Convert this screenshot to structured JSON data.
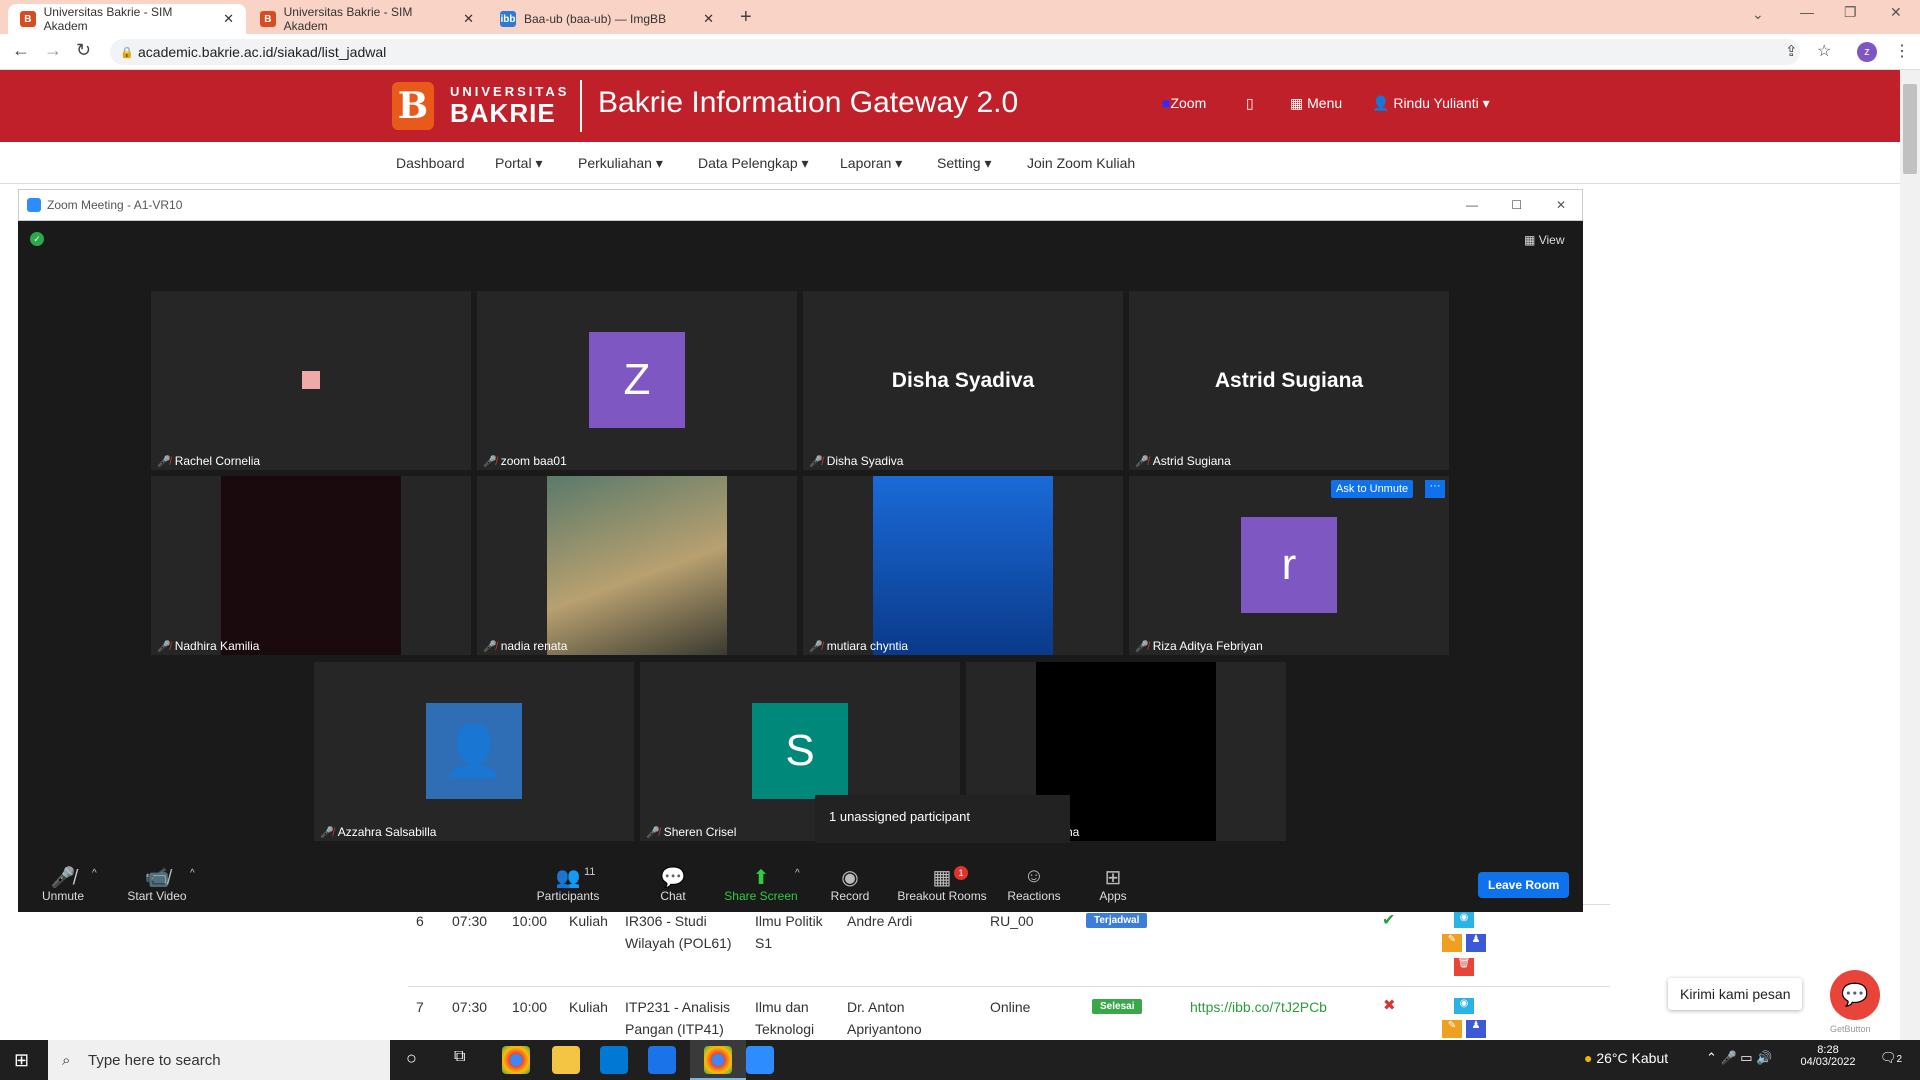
{
  "browser": {
    "tabs": [
      {
        "title": "Universitas Bakrie - SIM Akadem",
        "favicon": "B"
      },
      {
        "title": "Universitas Bakrie - SIM Akadem",
        "favicon": "B"
      },
      {
        "title": "Baa-ub (baa-ub) — ImgBB",
        "favicon": "ibb"
      }
    ],
    "url": "academic.bakrie.ac.id/siakad/list_jadwal"
  },
  "site": {
    "logo_letter": "B",
    "logo_top": "UNIVERSITAS",
    "logo_bottom": "BAKRIE",
    "title": "Bakrie Information Gateway 2.0",
    "zoom_label": "Zoom",
    "menu_label": "Menu",
    "user_label": "Rindu Yulianti ▾",
    "nav": [
      "Dashboard",
      "Portal ▾",
      "Perkuliahan ▾",
      "Data Pelengkap ▾",
      "Laporan ▾",
      "Setting ▾",
      "Join Zoom Kuliah"
    ]
  },
  "zoom": {
    "window_title": "Zoom Meeting - A1-VR10",
    "view_label": "View",
    "participants": [
      {
        "name": "Rachel Cornelia",
        "avatar": "",
        "avatar_color": "#f0a9a9"
      },
      {
        "name": "zoom baa01",
        "avatar": "Z",
        "avatar_color": "#7e57c2"
      },
      {
        "name": "Disha Syadiva",
        "big": "Disha Syadiva"
      },
      {
        "name": "Astrid Sugiana",
        "big": "Astrid Sugiana"
      },
      {
        "name": "Nadhira Kamilia"
      },
      {
        "name": "nadia renata"
      },
      {
        "name": "mutiara chyntia"
      },
      {
        "name": "Riza Aditya Febriyan",
        "avatar": "r",
        "avatar_color": "#7e57c2"
      },
      {
        "name": "Azzahra Salsabilla"
      },
      {
        "name": "Sheren Crisel",
        "avatar": "S",
        "avatar_color": "#00897b"
      },
      {
        "name": "ha"
      }
    ],
    "ask_unmute": "Ask to Unmute",
    "more": "···",
    "tooltip": "1 unassigned participant",
    "toolbar": {
      "unmute": "Unmute",
      "start_video": "Start Video",
      "participants": "Participants",
      "participants_count": "11",
      "chat": "Chat",
      "share": "Share Screen",
      "record": "Record",
      "breakout": "Breakout Rooms",
      "breakout_badge": "1",
      "reactions": "Reactions",
      "apps": "Apps",
      "leave": "Leave Room"
    }
  },
  "table": {
    "rows": [
      {
        "no": "6",
        "start": "07:30",
        "end": "10:00",
        "type": "Kuliah",
        "course": "IR306 - Studi Wilayah (POL61)",
        "prodi": "Ilmu Politik S1",
        "lecturer": "Andre Ardi",
        "room": "RU_00",
        "status": "Terjadwal",
        "link": "",
        "check": "✔"
      },
      {
        "no": "7",
        "start": "07:30",
        "end": "10:00",
        "type": "Kuliah",
        "course": "ITP231 - Analisis Pangan (ITP41)",
        "prodi": "Ilmu dan Teknologi",
        "lecturer": "Dr. Anton Apriyantono",
        "room": "Online",
        "status": "Selesai",
        "link": "https://ibb.co/7tJ2PCb",
        "check": "✖"
      }
    ]
  },
  "chat_widget": {
    "label": "Kirimi kami pesan",
    "brand": "GetButton"
  },
  "taskbar": {
    "search": "Type here to search",
    "weather": "26°C  Kabut",
    "time": "8:28",
    "date": "04/03/2022",
    "notif": "2"
  }
}
